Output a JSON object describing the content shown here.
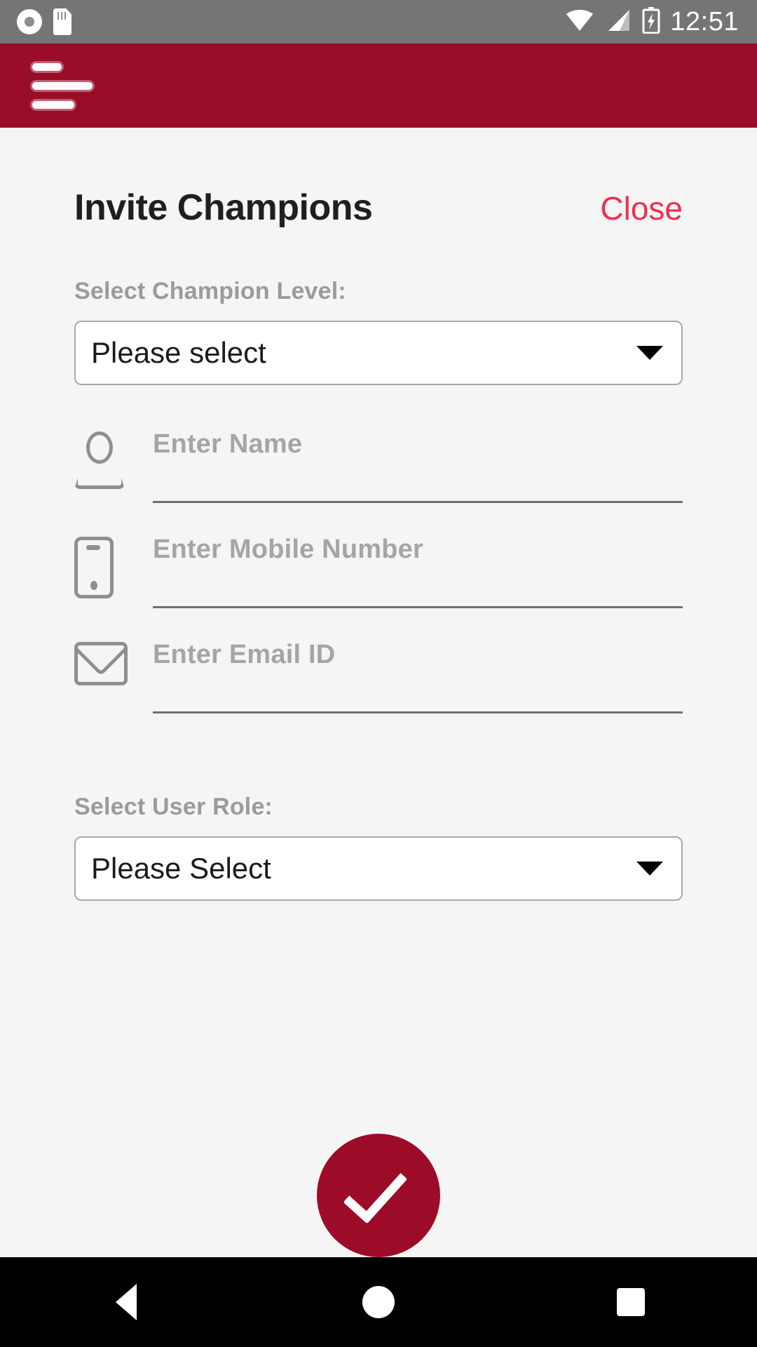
{
  "statusbar": {
    "time": "12:51",
    "icons": [
      "disc-icon",
      "sd-card-icon",
      "wifi-icon",
      "signal-icon",
      "battery-charging-icon"
    ]
  },
  "appbar": {
    "menu_icon": "hamburger-menu-icon",
    "background_color": "#990d28"
  },
  "header": {
    "title": "Invite Champions",
    "close_label": "Close",
    "close_color": "#ef2e53"
  },
  "form": {
    "champion_level": {
      "label": "Select Champion Level:",
      "value": "Please select"
    },
    "fields": [
      {
        "icon": "person-icon",
        "placeholder": "Enter Name",
        "value": ""
      },
      {
        "icon": "phone-icon",
        "placeholder": "Enter Mobile Number",
        "value": ""
      },
      {
        "icon": "envelope-icon",
        "placeholder": "Enter Email ID",
        "value": ""
      }
    ],
    "user_role": {
      "label": "Select User Role:",
      "value": "Please Select"
    },
    "submit": {
      "icon": "checkmark-icon",
      "color": "#9c0c28"
    }
  },
  "navbar": {
    "back": "back-triangle-icon",
    "home": "home-circle-icon",
    "recents": "recents-square-icon"
  }
}
